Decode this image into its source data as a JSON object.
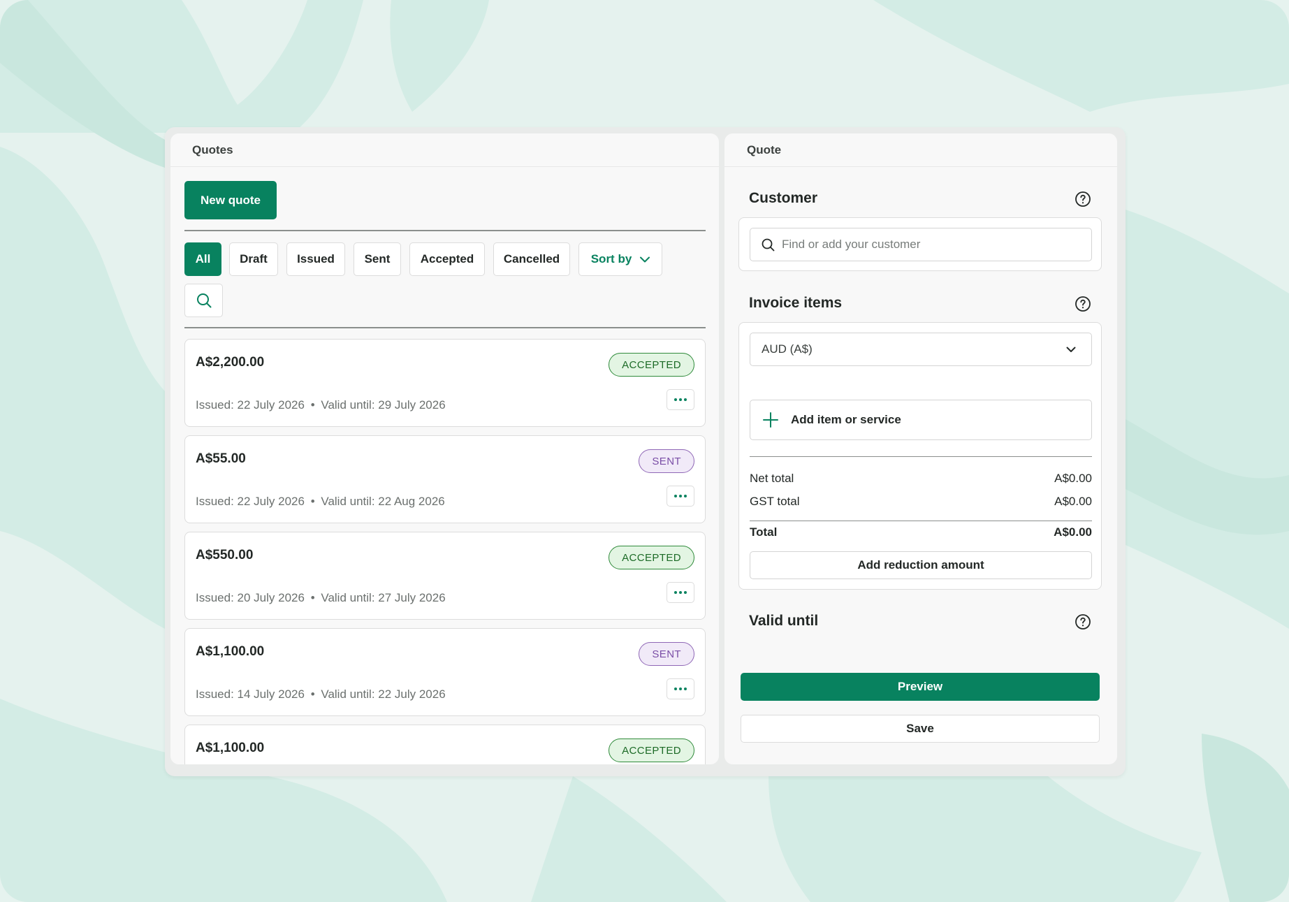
{
  "colors": {
    "brand": "#08825f",
    "accepted": "#1d6b27",
    "sent": "#7a4ea6"
  },
  "quotes_panel": {
    "title": "Quotes",
    "new_quote_label": "New quote",
    "filters": [
      "All",
      "Draft",
      "Issued",
      "Sent",
      "Accepted",
      "Cancelled"
    ],
    "active_filter": "All",
    "sort_label": "Sort by",
    "items": [
      {
        "amount": "A$2,200.00",
        "status": "ACCEPTED",
        "issued": "Issued: 22 July 2026",
        "sep": "•",
        "valid": "Valid until: 29 July 2026"
      },
      {
        "amount": "A$55.00",
        "status": "SENT",
        "issued": "Issued: 22 July 2026",
        "sep": "•",
        "valid": "Valid until: 22 Aug 2026"
      },
      {
        "amount": "A$550.00",
        "status": "ACCEPTED",
        "issued": "Issued: 20 July 2026",
        "sep": "•",
        "valid": "Valid until: 27 July 2026"
      },
      {
        "amount": "A$1,100.00",
        "status": "SENT",
        "issued": "Issued: 14 July 2026",
        "sep": "•",
        "valid": "Valid until: 22 July 2026"
      },
      {
        "amount": "A$1,100.00",
        "status": "ACCEPTED",
        "issued": "",
        "sep": "",
        "valid": ""
      }
    ]
  },
  "quote_panel": {
    "title": "Quote",
    "customer": {
      "heading": "Customer",
      "placeholder": "Find or add your customer"
    },
    "invoice_items": {
      "heading": "Invoice items",
      "currency": "AUD (A$)",
      "add_item_label": "Add item or service",
      "net_total_label": "Net total",
      "net_total_value": "A$0.00",
      "gst_total_label": "GST total",
      "gst_total_value": "A$0.00",
      "total_label": "Total",
      "total_value": "A$0.00",
      "reduction_label": "Add reduction amount"
    },
    "valid_until": {
      "heading": "Valid until"
    },
    "preview_label": "Preview",
    "save_label": "Save"
  }
}
